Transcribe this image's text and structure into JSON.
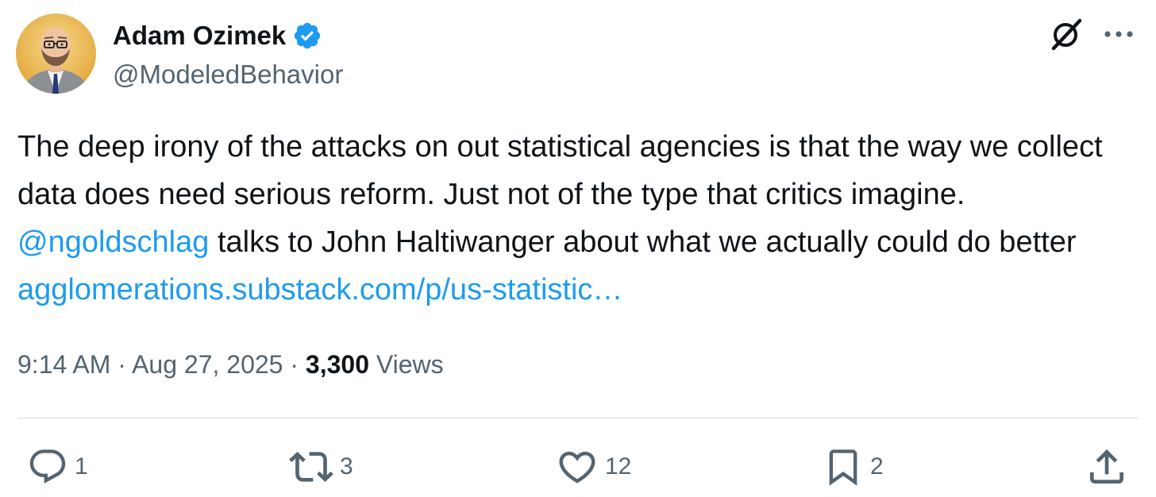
{
  "author": {
    "display_name": "Adam Ozimek",
    "handle": "@ModeledBehavior",
    "verified": true
  },
  "tweet": {
    "text_part1": "The deep irony of the attacks on out statistical agencies is that the way we collect data does need serious reform. Just not of the type that critics imagine. ",
    "mention": "@ngoldschlag",
    "text_part2": " talks to John Haltiwanger about what we actually could do better ",
    "link": "agglomerations.substack.com/p/us-statistic…"
  },
  "meta": {
    "time": "9:14 AM",
    "sep1": " · ",
    "date": "Aug 27, 2025",
    "sep2": " · ",
    "views_count": "3,300",
    "views_label": " Views"
  },
  "actions": {
    "reply_count": "1",
    "retweet_count": "3",
    "like_count": "12",
    "bookmark_count": "2"
  },
  "icons": {
    "verified": "verified-badge-icon",
    "grok": "grok-icon",
    "more": "more-icon",
    "reply": "reply-icon",
    "retweet": "retweet-icon",
    "like": "heart-icon",
    "bookmark": "bookmark-icon",
    "share": "share-icon"
  },
  "colors": {
    "text": "#0f1419",
    "secondary": "#536471",
    "link": "#1d9bf0",
    "verified": "#1d9bf0",
    "divider": "#cfd9de"
  }
}
